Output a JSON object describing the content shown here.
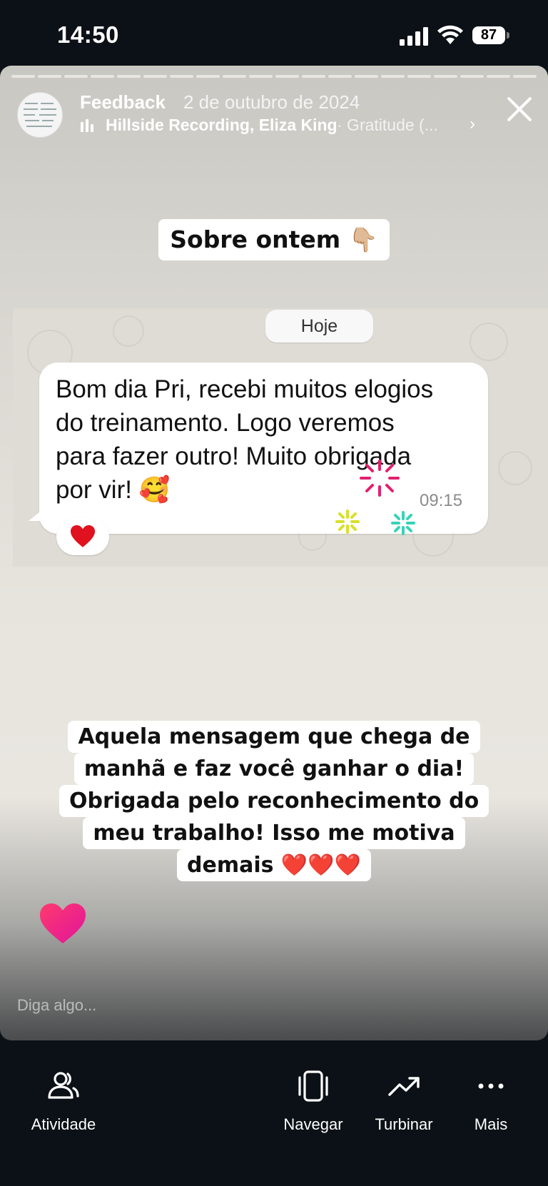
{
  "status_bar": {
    "time": "14:50",
    "battery": "87"
  },
  "story": {
    "title": "Feedback",
    "date": "2 de outubro de 2024",
    "music_artist": "Hillside Recording, Eliza King",
    "music_track": "· Gratitude (...",
    "progress_segments": 20
  },
  "sticker_top": "Sobre ontem 👇🏼",
  "chat": {
    "date_pill": "Hoje",
    "message_lines": [
      "Bom dia Pri, recebi muitos elogios",
      "do treinamento. Logo veremos",
      "para fazer outro! Muito obrigada",
      "por vir! 🥰"
    ],
    "message_time": "09:15",
    "reaction": "❤️"
  },
  "caption_lines": [
    "Aquela mensagem que chega de",
    "manhã e faz você ganhar o dia!",
    "Obrigada pelo reconhecimento do",
    "meu trabalho! Isso me motiva",
    "demais ❤️❤️❤️"
  ],
  "reply_placeholder": "Diga algo...",
  "tabs": [
    {
      "label": "Atividade",
      "icon": "activity-icon"
    },
    {
      "label": "Navegar",
      "icon": "navigate-icon"
    },
    {
      "label": "Turbinar",
      "icon": "boost-icon"
    },
    {
      "label": "Mais",
      "icon": "more-icon"
    }
  ],
  "colors": {
    "heart": "#ff2d6f",
    "background": "#0b1116"
  }
}
